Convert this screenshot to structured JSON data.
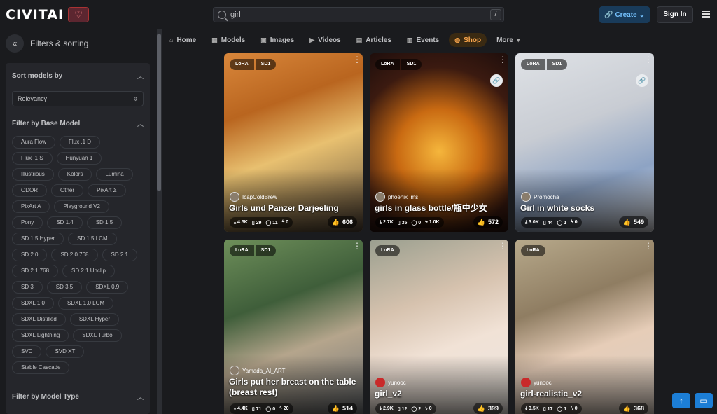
{
  "header": {
    "logo": "CIVITAI",
    "search_value": "girl",
    "search_shortcut": "/",
    "create_label": "Create",
    "signin_label": "Sign In"
  },
  "sidebar": {
    "title": "Filters & sorting",
    "sort_heading": "Sort models by",
    "sort_value": "Relevancy",
    "base_model_heading": "Filter by Base Model",
    "base_models": [
      "Aura Flow",
      "Flux .1 D",
      "Flux .1 S",
      "Hunyuan 1",
      "Illustrious",
      "Kolors",
      "Lumina",
      "ODOR",
      "Other",
      "PixArt Σ",
      "PixArt A",
      "Playground V2",
      "Pony",
      "SD 1.4",
      "SD 1.5",
      "SD 1.5 Hyper",
      "SD 1.5 LCM",
      "SD 2.0",
      "SD 2.0 768",
      "SD 2.1",
      "SD 2.1 768",
      "SD 2.1 Unclip",
      "SD 3",
      "SD 3.5",
      "SDXL 0.9",
      "SDXL 1.0",
      "SDXL 1.0 LCM",
      "SDXL Distilled",
      "SDXL Hyper",
      "SDXL Lightning",
      "SDXL Turbo",
      "SVD",
      "SVD XT",
      "Stable Cascade"
    ],
    "model_type_heading": "Filter by Model Type"
  },
  "nav": {
    "items": [
      "Home",
      "Models",
      "Images",
      "Videos",
      "Articles",
      "Events",
      "Shop",
      "More"
    ]
  },
  "cards": [
    {
      "badges": [
        "LoRA",
        "SD1"
      ],
      "creator": "IcapColdBrew",
      "title": "Girls und Panzer Darjeeling",
      "downloads": "4.5K",
      "saves": "29",
      "comments": "11",
      "tips": "0",
      "reactions": "606"
    },
    {
      "badges": [
        "LoRA",
        "SD1"
      ],
      "creator": "phoenix_ms",
      "title": "girls in glass bottle/瓶中少女",
      "downloads": "2.7K",
      "saves": "35",
      "comments": "0",
      "tips": "1.0K",
      "reactions": "572"
    },
    {
      "badges": [
        "LoRA",
        "SD1"
      ],
      "creator": "Promocha",
      "title": "Girl in white socks",
      "downloads": "3.0K",
      "saves": "44",
      "comments": "1",
      "tips": "0",
      "reactions": "549"
    },
    {
      "badges": [
        "LoRA",
        "SD1"
      ],
      "creator": "Yamada_AI_ART",
      "title": "Girls put her breast on the table (breast rest)",
      "downloads": "4.4K",
      "saves": "71",
      "comments": "0",
      "tips": "20",
      "reactions": "514"
    },
    {
      "badges": [
        "LoRA"
      ],
      "creator": "yunooc",
      "title": "girl_v2",
      "downloads": "2.9K",
      "saves": "12",
      "comments": "2",
      "tips": "0",
      "reactions": "399"
    },
    {
      "badges": [
        "LoRA"
      ],
      "creator": "yunooc",
      "title": "girl-realistic_v2",
      "downloads": "3.5K",
      "saves": "17",
      "comments": "1",
      "tips": "0",
      "reactions": "368"
    }
  ],
  "colors": {
    "accent": "#1c7ed6",
    "shop": "#ffa94d",
    "background": "#1a1b1e"
  }
}
